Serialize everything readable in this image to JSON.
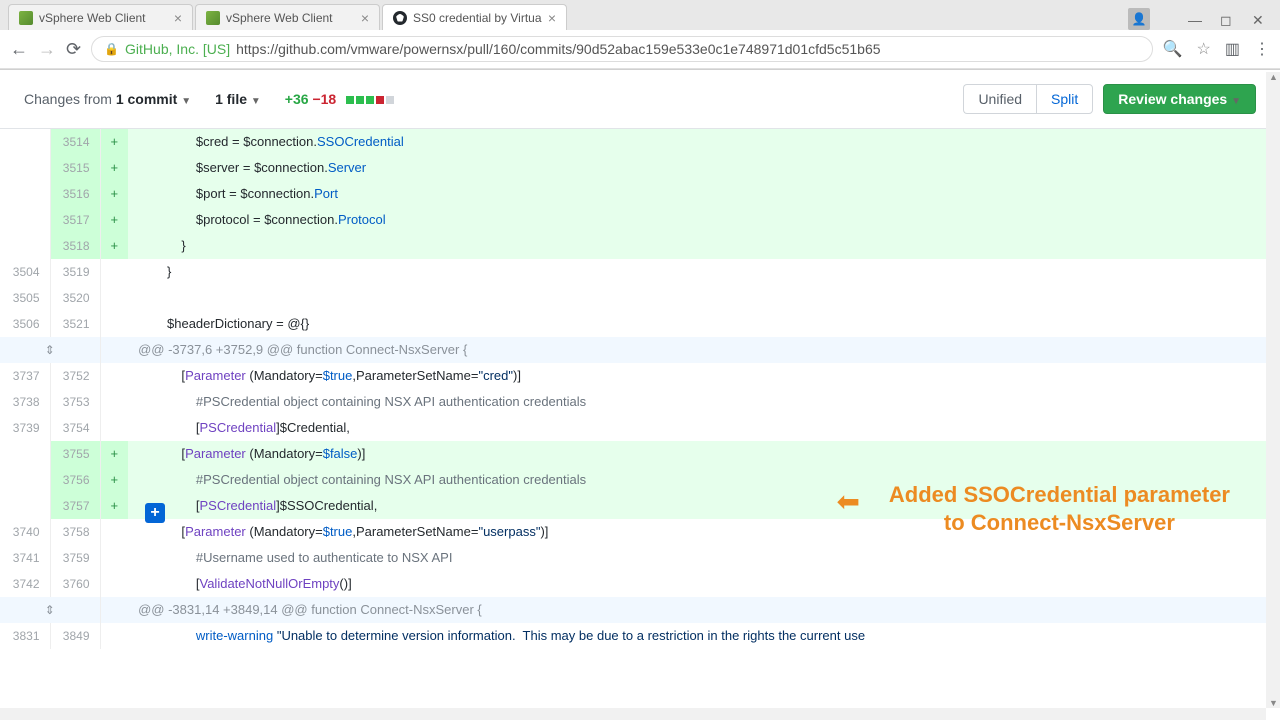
{
  "tabs": {
    "t1": "vSphere Web Client",
    "t2": "vSphere Web Client",
    "t3": "SS0 credential by Virtua"
  },
  "url": {
    "origin": "GitHub, Inc. [US]",
    "path": "https://github.com/vmware/powernsx/pull/160/commits/90d52abac159e533e0c1e748971d01cfd5c51b65"
  },
  "toolbar": {
    "changes_label": "Changes from ",
    "commits": "1 commit",
    "files": "1 file",
    "additions": "+36",
    "deletions": "−18",
    "unified": "Unified",
    "split": "Split",
    "review": "Review changes"
  },
  "lines": {
    "l0": {
      "old": "",
      "new": "3514",
      "m": "+",
      "code": "                $cred = $connection.SSOCredential"
    },
    "l1": {
      "old": "",
      "new": "3515",
      "m": "+",
      "code": "                $server = $connection.Server"
    },
    "l2": {
      "old": "",
      "new": "3516",
      "m": "+",
      "code": "                $port = $connection.Port"
    },
    "l3": {
      "old": "",
      "new": "3517",
      "m": "+",
      "code": "                $protocol = $connection.Protocol"
    },
    "l4": {
      "old": "",
      "new": "3518",
      "m": "+",
      "code": "            }"
    },
    "l5": {
      "old": "3504",
      "new": "3519",
      "m": " ",
      "code": "        }"
    },
    "l6": {
      "old": "3505",
      "new": "3520",
      "m": " ",
      "code": ""
    },
    "l7": {
      "old": "3506",
      "new": "3521",
      "m": " ",
      "code": "        $headerDictionary = @{}"
    },
    "h1": "@@ -3737,6 +3752,9 @@ function Connect-NsxServer {",
    "l8": {
      "old": "3737",
      "new": "3752",
      "m": " ",
      "code": "            [Parameter (Mandatory=$true,ParameterSetName=\"cred\")]"
    },
    "l9": {
      "old": "3738",
      "new": "3753",
      "m": " ",
      "code": "                #PSCredential object containing NSX API authentication credentials"
    },
    "l10": {
      "old": "3739",
      "new": "3754",
      "m": " ",
      "code": "                [PSCredential]$Credential,"
    },
    "l11": {
      "old": "",
      "new": "3755",
      "m": "+",
      "code": "            [Parameter (Mandatory=$false)]"
    },
    "l12": {
      "old": "",
      "new": "3756",
      "m": "+",
      "code": "                #PSCredential object containing NSX API authentication credentials"
    },
    "l13": {
      "old": "",
      "new": "3757",
      "m": "+",
      "code": "                [PSCredential]$SSOCredential,"
    },
    "l14": {
      "old": "3740",
      "new": "3758",
      "m": " ",
      "code": "            [Parameter (Mandatory=$true,ParameterSetName=\"userpass\")]"
    },
    "l15": {
      "old": "3741",
      "new": "3759",
      "m": " ",
      "code": "                #Username used to authenticate to NSX API"
    },
    "l16": {
      "old": "3742",
      "new": "3760",
      "m": " ",
      "code": "                [ValidateNotNullOrEmpty()]"
    },
    "h2": "@@ -3831,14 +3849,14 @@ function Connect-NsxServer {",
    "l17": {
      "old": "3831",
      "new": "3849",
      "m": " ",
      "code": "                write-warning \"Unable to determine version information.  This may be due to a restriction in the rights the current use"
    }
  },
  "annotation": {
    "line1": "Added SSOCredential parameter",
    "line2": "to Connect-NsxServer"
  }
}
